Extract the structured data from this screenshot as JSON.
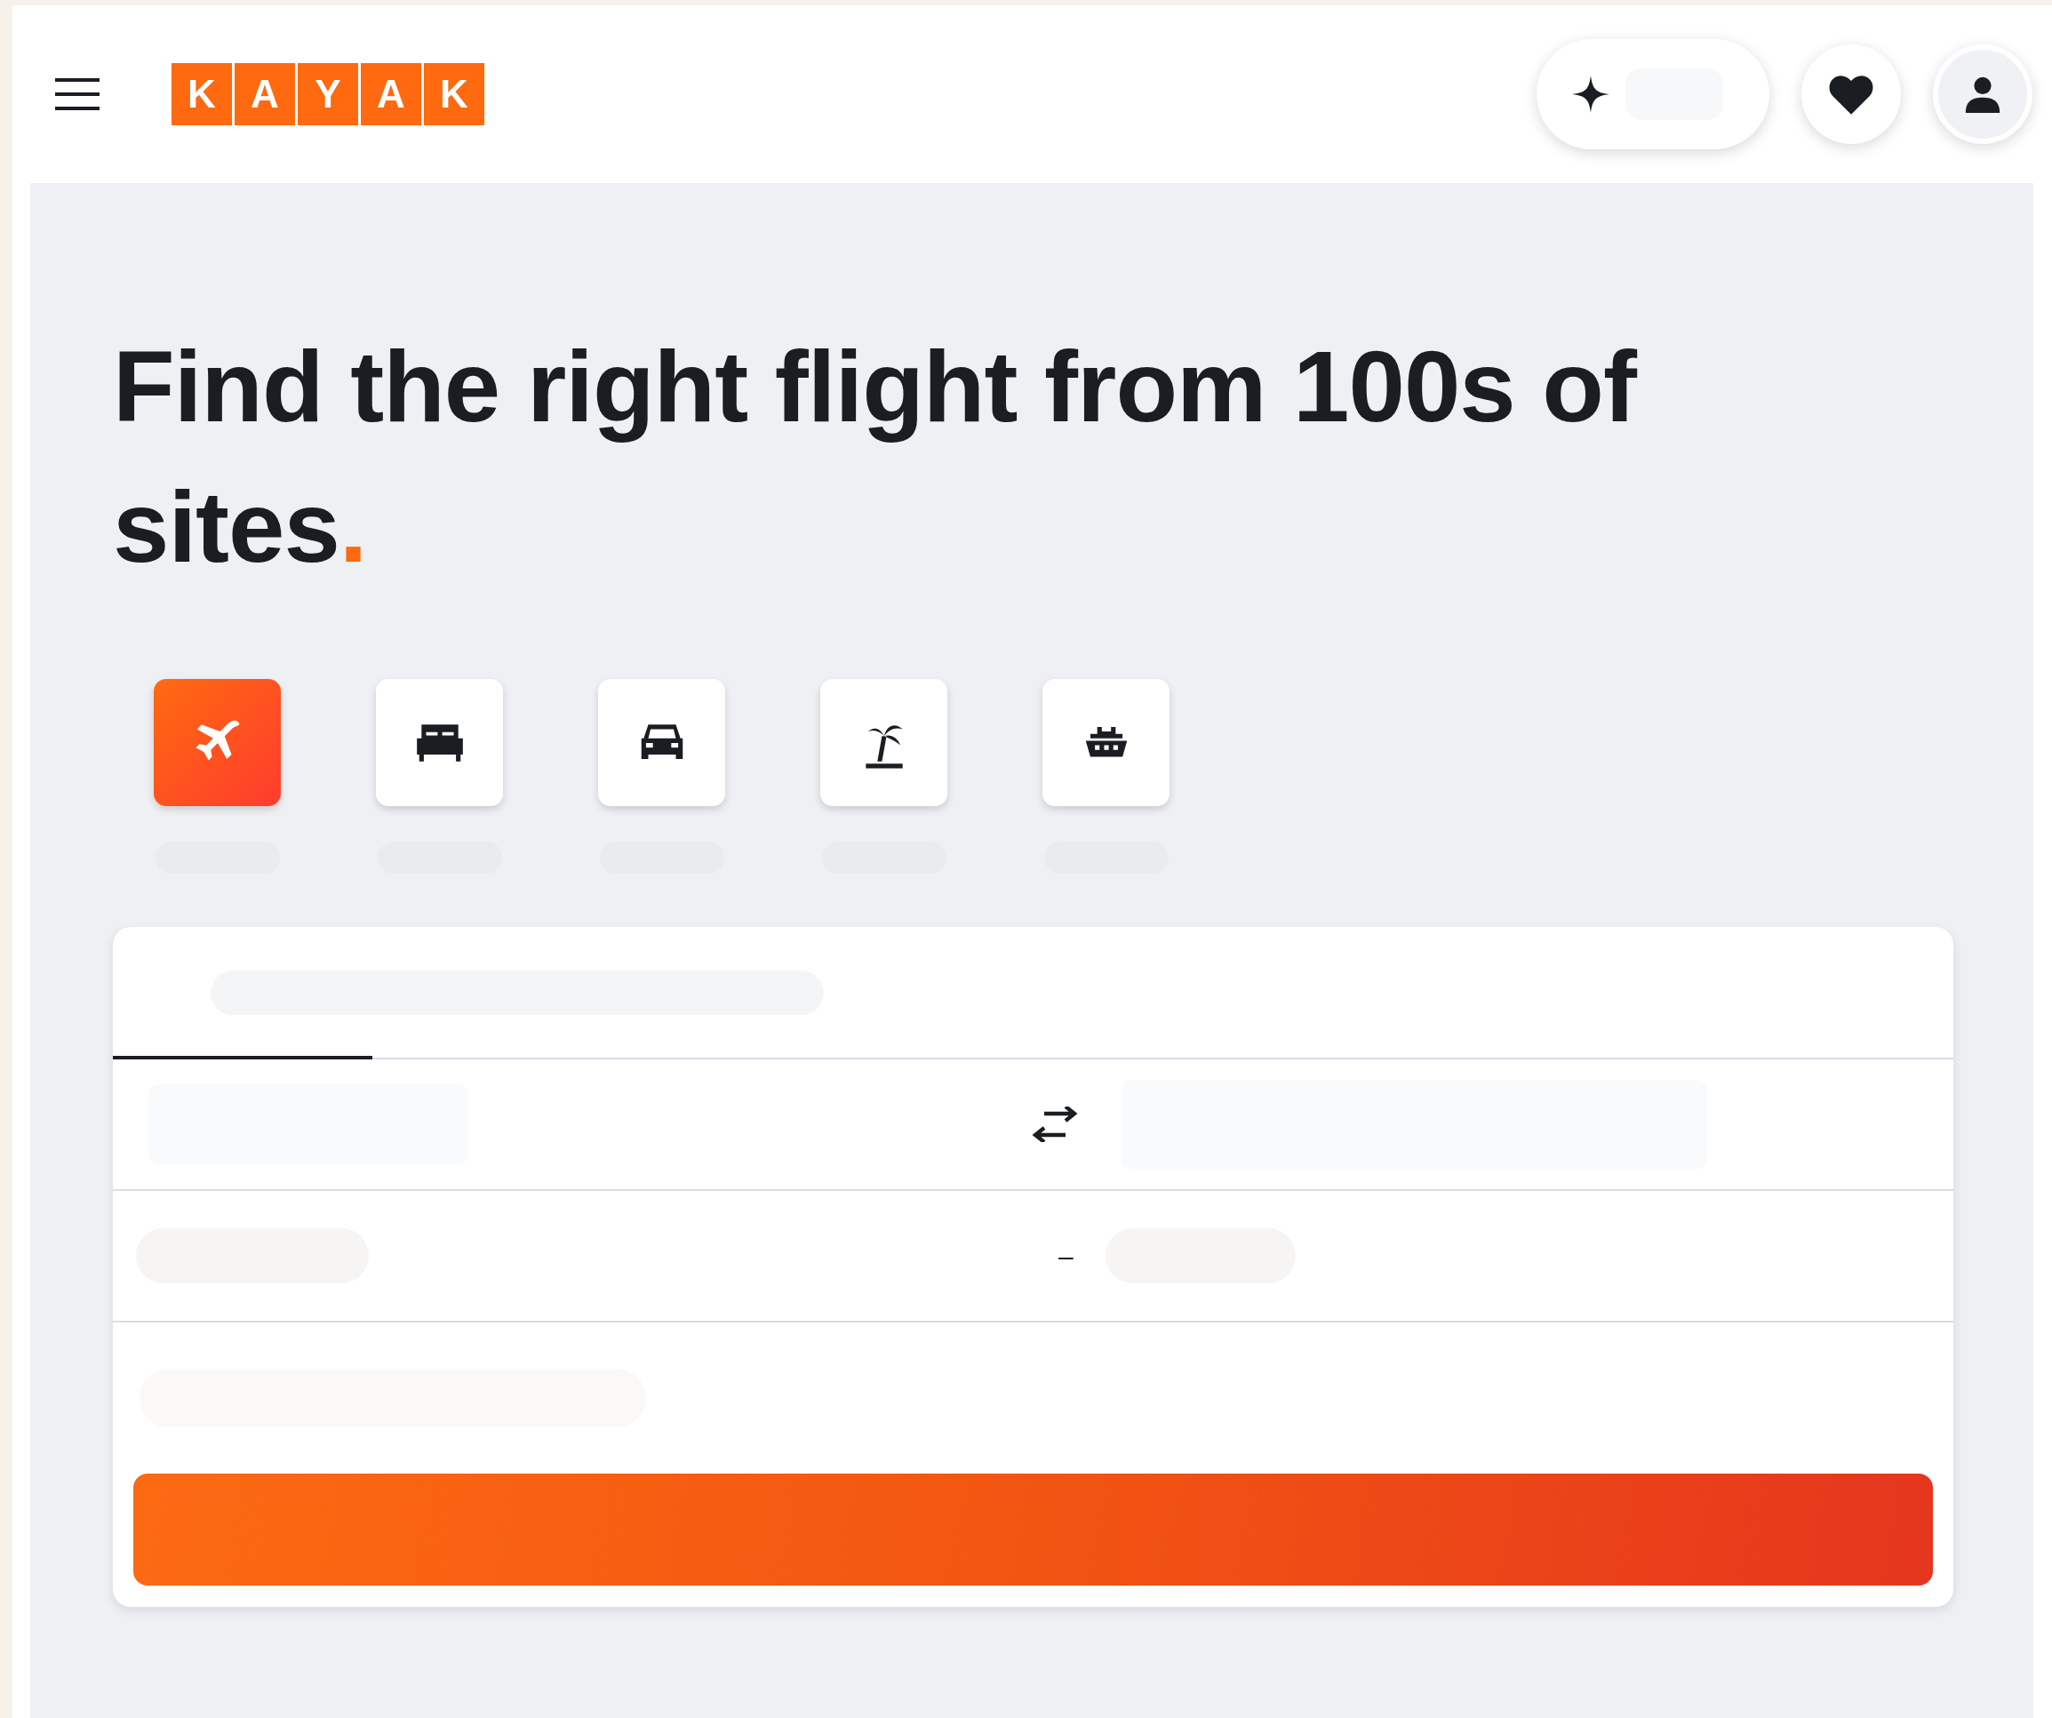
{
  "header": {
    "logo_letters": [
      "K",
      "A",
      "Y",
      "A",
      "K"
    ]
  },
  "hero": {
    "headline": "Find the right flight from 100s of sites",
    "headline_end": "."
  },
  "verticals": [
    {
      "kind": "flight",
      "selected": true
    },
    {
      "kind": "bed",
      "selected": false
    },
    {
      "kind": "car",
      "selected": false
    },
    {
      "kind": "palm",
      "selected": false
    },
    {
      "kind": "ship",
      "selected": false
    }
  ],
  "search_form": {
    "date_separator": "–"
  }
}
